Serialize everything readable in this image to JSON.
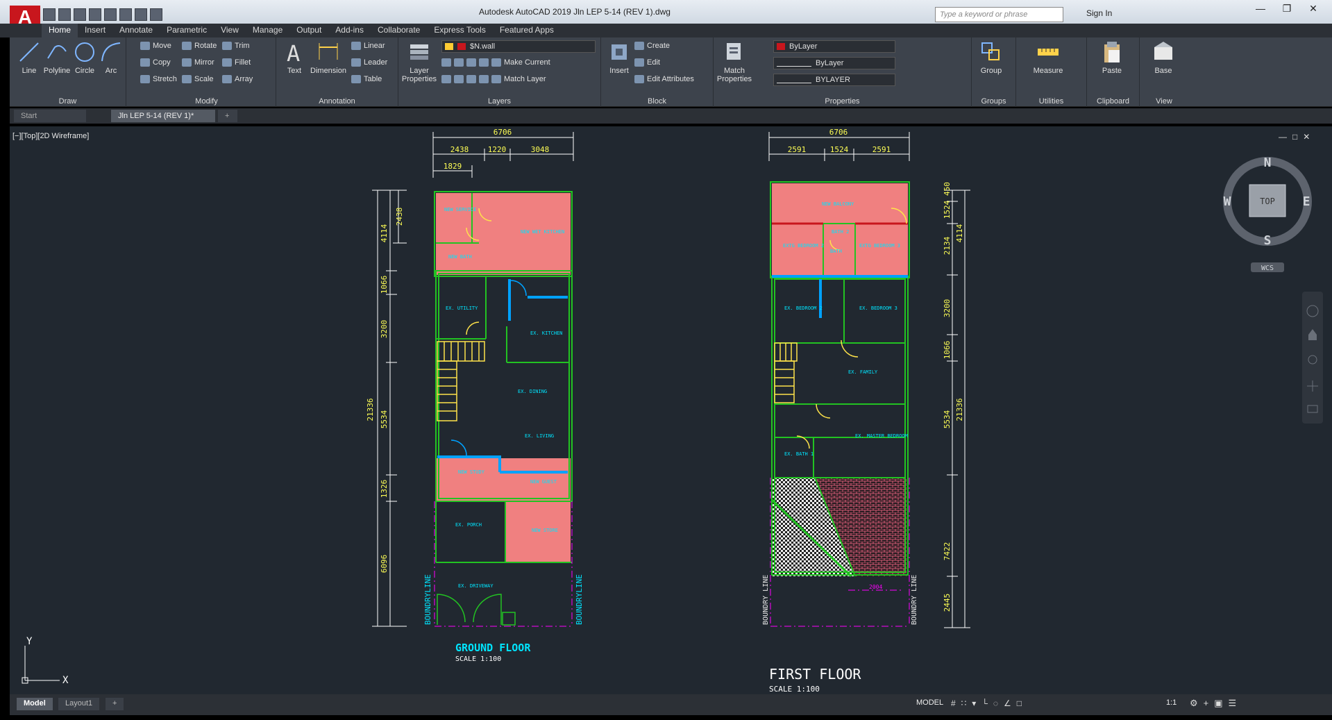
{
  "app": {
    "title": "Autodesk AutoCAD 2019    Jln LEP 5-14 (REV 1).dwg",
    "logo": "A",
    "search_placeholder": "Type a keyword or phrase",
    "sign_in": "Sign In"
  },
  "ribbon_tabs": [
    "Home",
    "Insert",
    "Annotate",
    "Parametric",
    "View",
    "Manage",
    "Output",
    "Add-ins",
    "Collaborate",
    "Express Tools",
    "Featured Apps"
  ],
  "draw": {
    "title": "Draw",
    "line": "Line",
    "polyline": "Polyline",
    "circle": "Circle",
    "arc": "Arc"
  },
  "modify": {
    "title": "Modify",
    "move": "Move",
    "rotate": "Rotate",
    "trim": "Trim",
    "copy": "Copy",
    "mirror": "Mirror",
    "fillet": "Fillet",
    "stretch": "Stretch",
    "scale": "Scale",
    "array": "Array"
  },
  "annotation": {
    "title": "Annotation",
    "text": "Text",
    "dimension": "Dimension",
    "linear": "Linear",
    "leader": "Leader",
    "table": "Table"
  },
  "layers": {
    "title": "Layers",
    "layer_properties_1": "Layer",
    "layer_properties_2": "Properties",
    "current_layer": "$N.wall",
    "make_current": "Make Current",
    "match_layer": "Match Layer"
  },
  "block": {
    "title": "Block",
    "insert": "Insert",
    "create": "Create",
    "edit": "Edit",
    "edit_attributes": "Edit Attributes"
  },
  "properties": {
    "title": "Properties",
    "match_1": "Match",
    "match_2": "Properties",
    "color": "ByLayer",
    "linetype": "ByLayer",
    "lineweight": "BYLAYER"
  },
  "groups": {
    "title": "Groups",
    "group": "Group"
  },
  "utilities": {
    "title": "Utilities",
    "measure": "Measure"
  },
  "clipboard": {
    "title": "Clipboard",
    "paste": "Paste"
  },
  "view_panel": {
    "title": "View",
    "base": "Base"
  },
  "doc_tabs": {
    "start": "Start",
    "file": "Jln LEP 5-14 (REV 1)*"
  },
  "viewport_label": "[−][Top][2D Wireframe]",
  "viewcube": {
    "n": "N",
    "s": "S",
    "e": "E",
    "w": "W",
    "top": "TOP",
    "wcs": "WCS"
  },
  "ucs": {
    "x": "X",
    "y": "Y"
  },
  "ground_floor": {
    "title": "GROUND FLOOR",
    "scale": "SCALE 1:100",
    "dims_top": [
      "6706",
      "2438",
      "1220",
      "3048",
      "1829"
    ],
    "dims_left": [
      "21336",
      "4114",
      "2438",
      "1066",
      "3200",
      "5534",
      "1326",
      "6096"
    ],
    "rooms": [
      "NEW SERVICE",
      "NEW WET KITCHEN",
      "NEW BATH",
      "EX. UTILITY",
      "EX. KITCHEN",
      "EX. DINING",
      "EX. LIVING",
      "NEW STUDY",
      "NEW GUEST",
      "EX. PORCH",
      "NEW STORE",
      "EX. DRIVEWAY"
    ],
    "boundary": "BOUNDRYLINE"
  },
  "first_floor": {
    "title": "FIRST FLOOR",
    "scale": "SCALE 1:100",
    "dims_top": [
      "6706",
      "2591",
      "1524",
      "2591"
    ],
    "dims_right": [
      "21336",
      "450",
      "1524",
      "2134",
      "4114",
      "3200",
      "1066",
      "5534",
      "7422",
      "2445"
    ],
    "rooms": [
      "NEW BALCONY",
      "BATH 2",
      "BATH",
      "EXTG BEDROOM 2",
      "EXTG BEDROOM 3",
      "EX. BEDROOM 2",
      "EX. BEDROOM 3",
      "EX. FAMILY",
      "EX. MASTER BEDROOM",
      "EX. BATH 1"
    ],
    "boundary": "BOUNDRY LINE",
    "slab": "2004"
  },
  "status": {
    "model_tab": "Model",
    "layout_tab": "Layout1",
    "model": "MODEL",
    "scale": "1:1"
  },
  "colors": {
    "canvas": "#212830",
    "wall": "#22c322",
    "new_room": "#f08080",
    "dim": "#ffff55",
    "cyan": "#00e5ff",
    "blue_wall": "#00a2ff",
    "magenta": "#ff00ff"
  }
}
